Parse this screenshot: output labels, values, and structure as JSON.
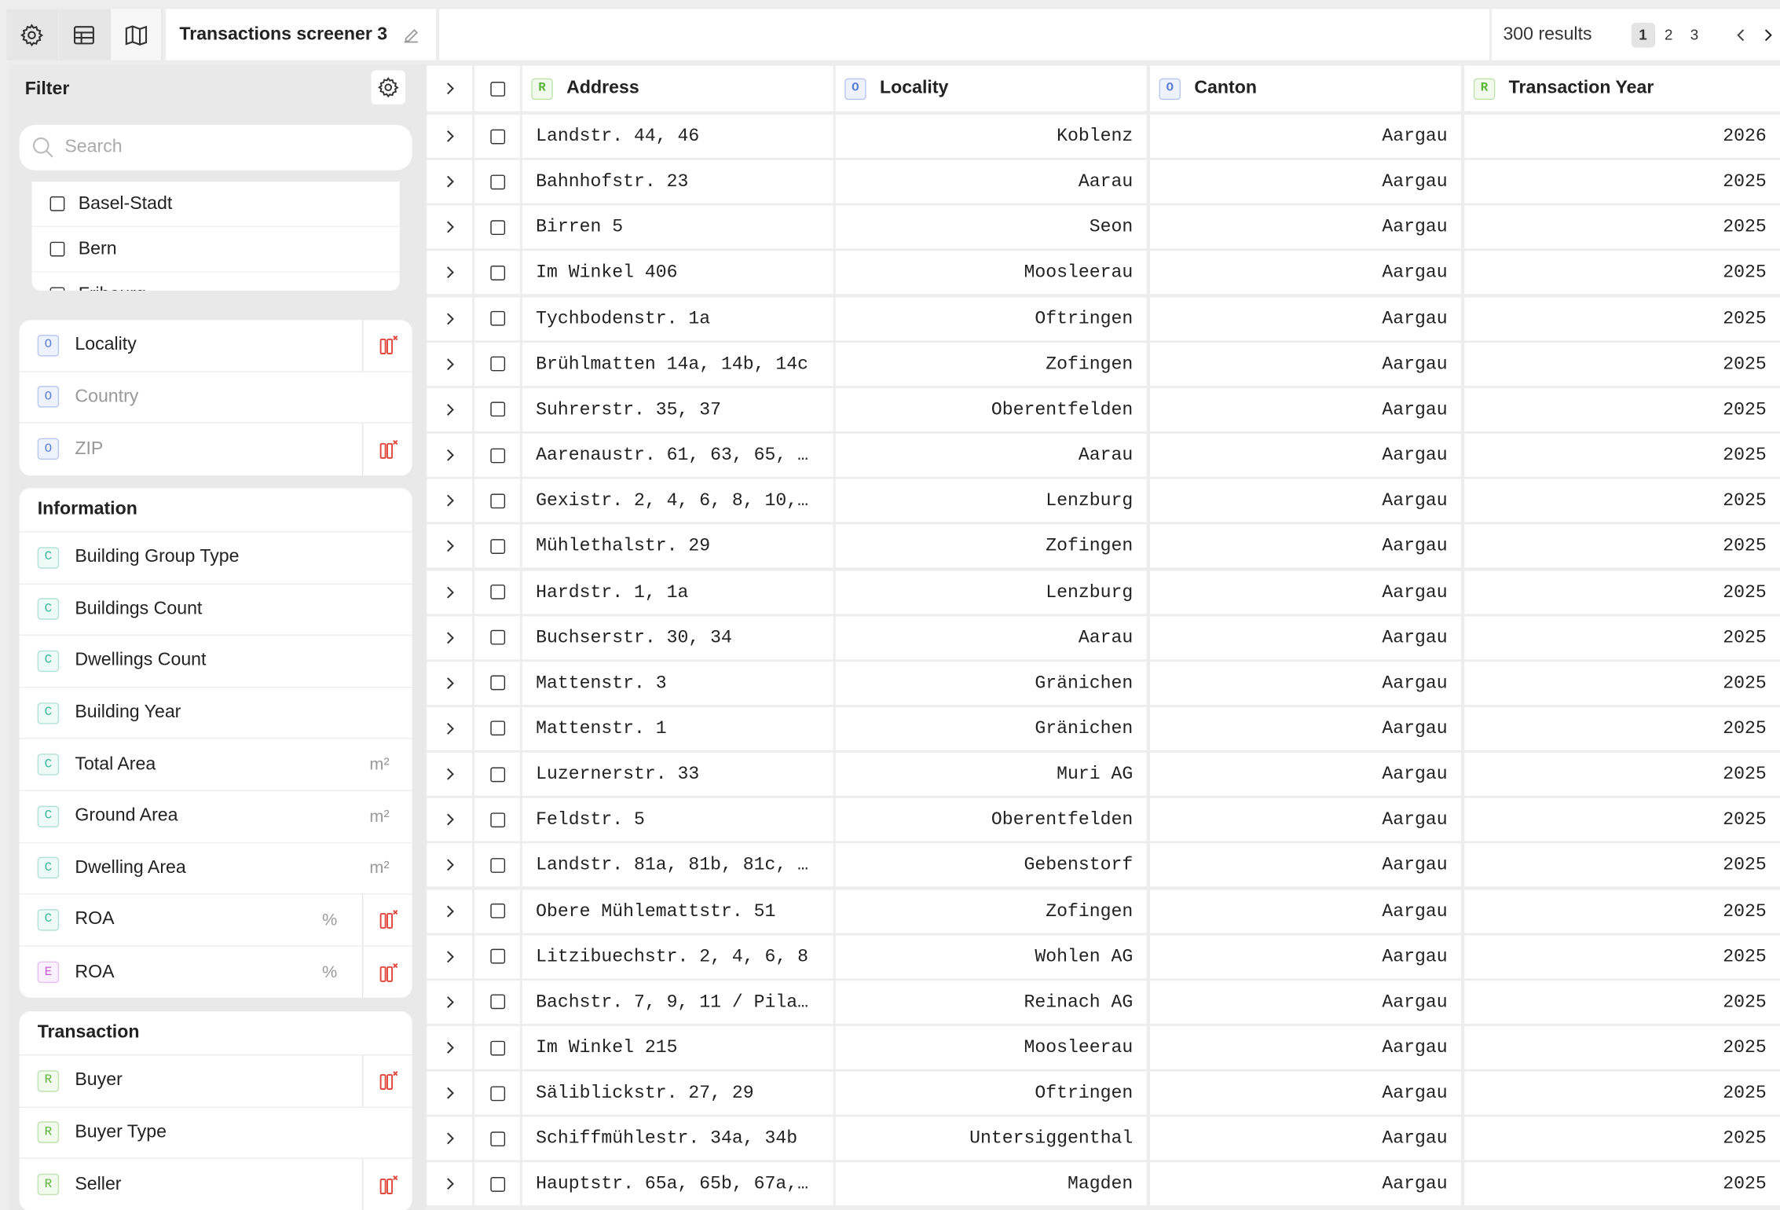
{
  "topbar": {
    "title": "Transactions screener 3",
    "results": "300 results",
    "pages": [
      "1",
      "2",
      "3"
    ],
    "current_page": "1"
  },
  "sidebar": {
    "header": "Filter",
    "search_placeholder": "Search",
    "cantons": [
      "Basel-Stadt",
      "Bern",
      "Fribourg"
    ],
    "location_fields": [
      {
        "badge": "O",
        "label": "Locality",
        "dim": false,
        "delete": true
      },
      {
        "badge": "O",
        "label": "Country",
        "dim": true,
        "delete": false
      },
      {
        "badge": "O",
        "label": "ZIP",
        "dim": true,
        "delete": true
      }
    ],
    "information": {
      "title": "Information",
      "fields": [
        {
          "badge": "C",
          "label": "Building Group Type",
          "unit": "",
          "delete": false
        },
        {
          "badge": "C",
          "label": "Buildings Count",
          "unit": "",
          "delete": false
        },
        {
          "badge": "C",
          "label": "Dwellings Count",
          "unit": "",
          "delete": false
        },
        {
          "badge": "C",
          "label": "Building Year",
          "unit": "",
          "delete": false
        },
        {
          "badge": "C",
          "label": "Total Area",
          "unit": "m²",
          "delete": false
        },
        {
          "badge": "C",
          "label": "Ground Area",
          "unit": "m²",
          "delete": false
        },
        {
          "badge": "C",
          "label": "Dwelling Area",
          "unit": "m²",
          "delete": false
        },
        {
          "badge": "C",
          "label": "ROA",
          "unit": "%",
          "delete": true
        },
        {
          "badge": "E",
          "label": "ROA",
          "unit": "%",
          "delete": true
        }
      ]
    },
    "transaction": {
      "title": "Transaction",
      "fields": [
        {
          "badge": "R",
          "label": "Buyer",
          "unit": "",
          "delete": true
        },
        {
          "badge": "R",
          "label": "Buyer Type",
          "unit": "",
          "delete": false
        },
        {
          "badge": "R",
          "label": "Seller",
          "unit": "",
          "delete": true
        }
      ]
    }
  },
  "table": {
    "columns": [
      {
        "badge": "R",
        "label": "Address"
      },
      {
        "badge": "O",
        "label": "Locality"
      },
      {
        "badge": "O",
        "label": "Canton"
      },
      {
        "badge": "R",
        "label": "Transaction Year"
      }
    ],
    "rows": [
      [
        "Landstr. 44, 46",
        "Koblenz",
        "Aargau",
        "2026"
      ],
      [
        "Bahnhofstr. 23",
        "Aarau",
        "Aargau",
        "2025"
      ],
      [
        "Birren 5",
        "Seon",
        "Aargau",
        "2025"
      ],
      [
        "Im Winkel 406",
        "Moosleerau",
        "Aargau",
        "2025"
      ],
      [
        "Tychbodenstr. 1a",
        "Oftringen",
        "Aargau",
        "2025"
      ],
      [
        "Brühlmatten 14a, 14b, 14c",
        "Zofingen",
        "Aargau",
        "2025"
      ],
      [
        "Suhrerstr. 35, 37",
        "Oberentfelden",
        "Aargau",
        "2025"
      ],
      [
        "Aarenaustr. 61, 63, 65, …",
        "Aarau",
        "Aargau",
        "2025"
      ],
      [
        "Gexistr. 2, 4, 6, 8, 10,…",
        "Lenzburg",
        "Aargau",
        "2025"
      ],
      [
        "Mühlethalstr. 29",
        "Zofingen",
        "Aargau",
        "2025"
      ],
      [
        "Hardstr. 1, 1a",
        "Lenzburg",
        "Aargau",
        "2025"
      ],
      [
        "Buchserstr. 30, 34",
        "Aarau",
        "Aargau",
        "2025"
      ],
      [
        "Mattenstr. 3",
        "Gränichen",
        "Aargau",
        "2025"
      ],
      [
        "Mattenstr. 1",
        "Gränichen",
        "Aargau",
        "2025"
      ],
      [
        "Luzernerstr. 33",
        "Muri AG",
        "Aargau",
        "2025"
      ],
      [
        "Feldstr. 5",
        "Oberentfelden",
        "Aargau",
        "2025"
      ],
      [
        "Landstr. 81a, 81b, 81c, …",
        "Gebenstorf",
        "Aargau",
        "2025"
      ],
      [
        "Obere Mühlemattstr. 51",
        "Zofingen",
        "Aargau",
        "2025"
      ],
      [
        "Litzibuechstr. 2, 4, 6, 8",
        "Wohlen AG",
        "Aargau",
        "2025"
      ],
      [
        "Bachstr. 7, 9, 11 / Pila…",
        "Reinach AG",
        "Aargau",
        "2025"
      ],
      [
        "Im Winkel 215",
        "Moosleerau",
        "Aargau",
        "2025"
      ],
      [
        "Säliblickstr. 27, 29",
        "Oftringen",
        "Aargau",
        "2025"
      ],
      [
        "Schiffmühlestr. 34a, 34b",
        "Untersiggenthal",
        "Aargau",
        "2025"
      ],
      [
        "Hauptstr. 65a, 65b, 67a,…",
        "Magden",
        "Aargau",
        "2025"
      ]
    ]
  },
  "colors": {
    "delete_icon": "#e0483e",
    "badge_O": "#5a7fd6",
    "badge_C": "#35b59a",
    "badge_R": "#5bb33a",
    "badge_E": "#c65ad6"
  }
}
